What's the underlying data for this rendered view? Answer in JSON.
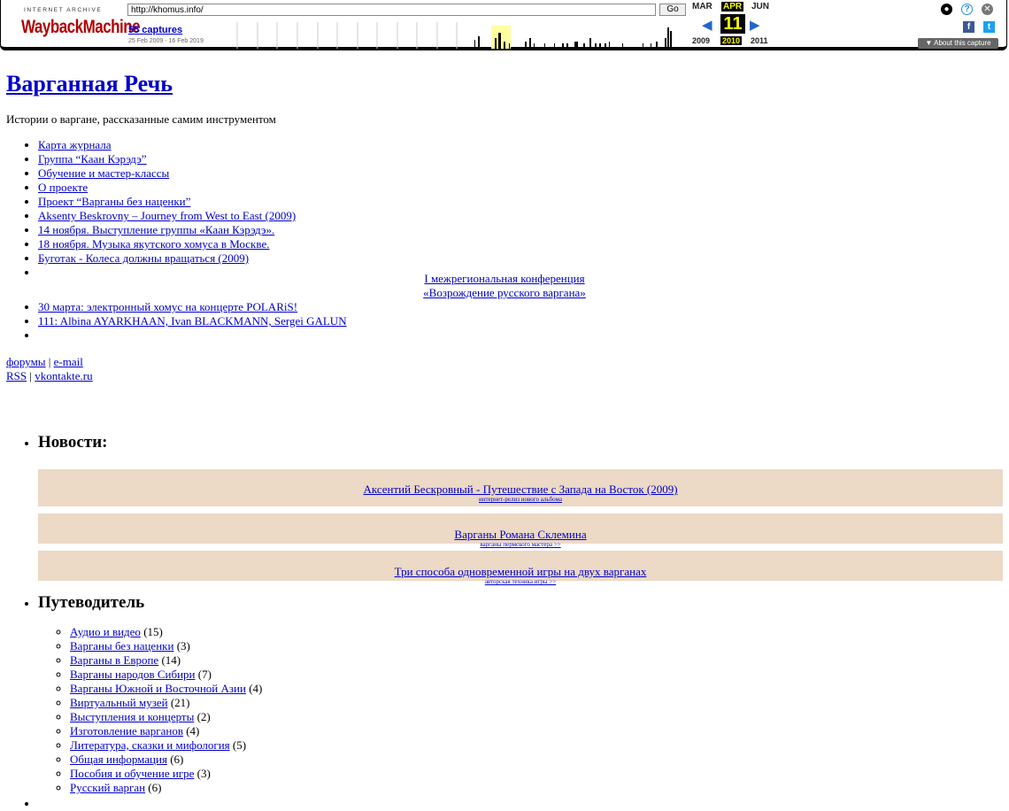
{
  "wayback": {
    "ia_text": "INTERNET ARCHIVE",
    "logo_text": "WaybackMachine",
    "url_value": "http://khomus.info/",
    "go_label": "Go",
    "captures_label": "55 captures",
    "date_range": "25 Feb 2009 - 16 Feb 2019",
    "months": {
      "prev": "MAR",
      "current": "APR",
      "next": "JUN"
    },
    "day": "11",
    "years": {
      "prev": "2009",
      "current": "2010",
      "next": "2011"
    },
    "about_label": "About this capture",
    "accent_color": "#ffff00"
  },
  "site": {
    "title": "Варганная Речь",
    "description": "Истории о варгане, рассказанные самим инструментом",
    "menu": [
      "Карта журнала",
      "Группа “Каан Кэрэдэ”",
      "Обучение и мастер-классы",
      "О проекте",
      "Проект “Варганы без наценки”",
      "Aksenty Beskrovny – Journey from West to East (2009)",
      "14 ноября. Выступление группы «Каан Кэрэдэ».",
      "18 ноября. Музыка якутского хомуса в Москве.",
      "Буготак - Колеса должны вращаться (2009)"
    ],
    "conference_line1": "I межрегиональная конференция",
    "conference_line2": "«Возрождение русского варгана»",
    "menu2": [
      "30 марта: электронный хомус на концерте POLARiS!",
      "111: Albina AYARKHAAN, Ivan BLACKMANN, Sergei GALUN"
    ],
    "links": {
      "forums": "форумы",
      "email": "e-mail",
      "rss": "RSS",
      "vk": "vkontakte.ru",
      "sep": "|"
    }
  },
  "news": {
    "title": "Новости:",
    "items": [
      {
        "title": "Аксентий Бескровный - Путешествие с Запада на Восток (2009)",
        "sub": "интернет-релиз нового альбома"
      },
      {
        "title": "Варганы Романа Склемина",
        "sub": "варганы пермского мастера >>"
      },
      {
        "title": "Три способа одновременной игры на двух варганах",
        "sub": "авторская техника игры >>"
      }
    ]
  },
  "guide": {
    "title": "Путеводитель",
    "items": [
      {
        "label": "Аудио и видео",
        "count": "(15)"
      },
      {
        "label": "Варганы без наценки",
        "count": "(3)"
      },
      {
        "label": "Варганы в Европе",
        "count": "(14)"
      },
      {
        "label": "Варганы народов Сибири",
        "count": "(7)"
      },
      {
        "label": "Варганы Южной и Восточной Азии",
        "count": "(4)"
      },
      {
        "label": "Виртуальный музей",
        "count": "(21)"
      },
      {
        "label": "Выступления и концерты",
        "count": "(2)"
      },
      {
        "label": "Изготовление варганов",
        "count": "(4)"
      },
      {
        "label": "Литература, сказки и мифология",
        "count": "(5)"
      },
      {
        "label": "Общая информация",
        "count": "(6)"
      },
      {
        "label": "Пособия и обучение игре",
        "count": "(3)"
      },
      {
        "label": "Русский варган",
        "count": "(6)"
      }
    ]
  }
}
